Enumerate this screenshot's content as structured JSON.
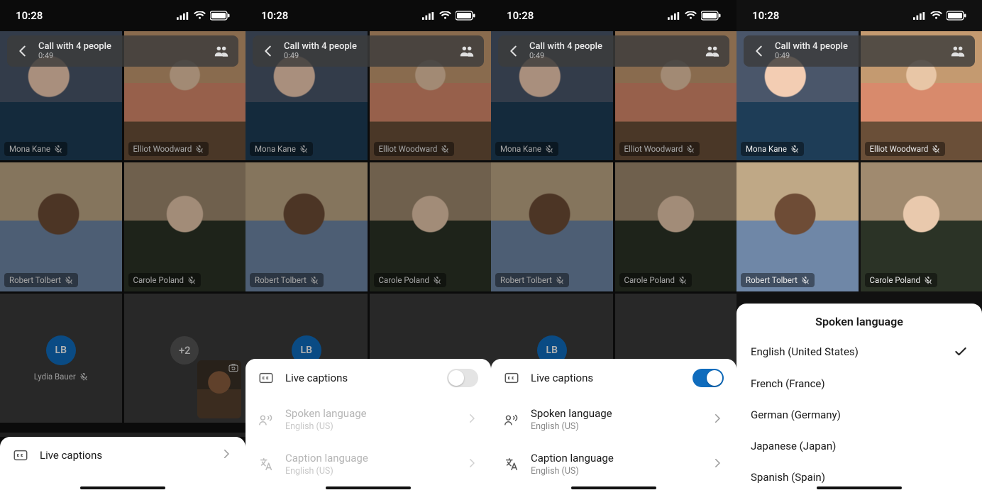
{
  "status_bar": {
    "time": "10:28"
  },
  "call_bar": {
    "title": "Call with 4 people",
    "duration": "0:49"
  },
  "participants": [
    {
      "name": "Mona Kane"
    },
    {
      "name": "Elliot Woodward"
    },
    {
      "name": "Robert Tolbert"
    },
    {
      "name": "Carole Poland"
    }
  ],
  "lydia": {
    "initials": "LB",
    "name": "Lydia Bauer",
    "color": "#0f6cbd"
  },
  "more_badge": "+2",
  "sheets": {
    "entry": {
      "label": "Live captions"
    },
    "settings_off": {
      "live_captions_label": "Live captions",
      "spoken_label": "Spoken language",
      "spoken_value": "English (US)",
      "caption_label": "Caption language",
      "caption_value": "English (US)"
    },
    "settings_on": {
      "live_captions_label": "Live captions",
      "spoken_label": "Spoken language",
      "spoken_value": "English (US)",
      "caption_label": "Caption language",
      "caption_value": "English (US)"
    },
    "language_picker": {
      "title": "Spoken language",
      "options": [
        {
          "label": "English (United States)",
          "selected": true
        },
        {
          "label": "French (France)",
          "selected": false
        },
        {
          "label": "German (Germany)",
          "selected": false
        },
        {
          "label": "Japanese (Japan)",
          "selected": false
        },
        {
          "label": "Spanish (Spain)",
          "selected": false
        }
      ]
    }
  }
}
